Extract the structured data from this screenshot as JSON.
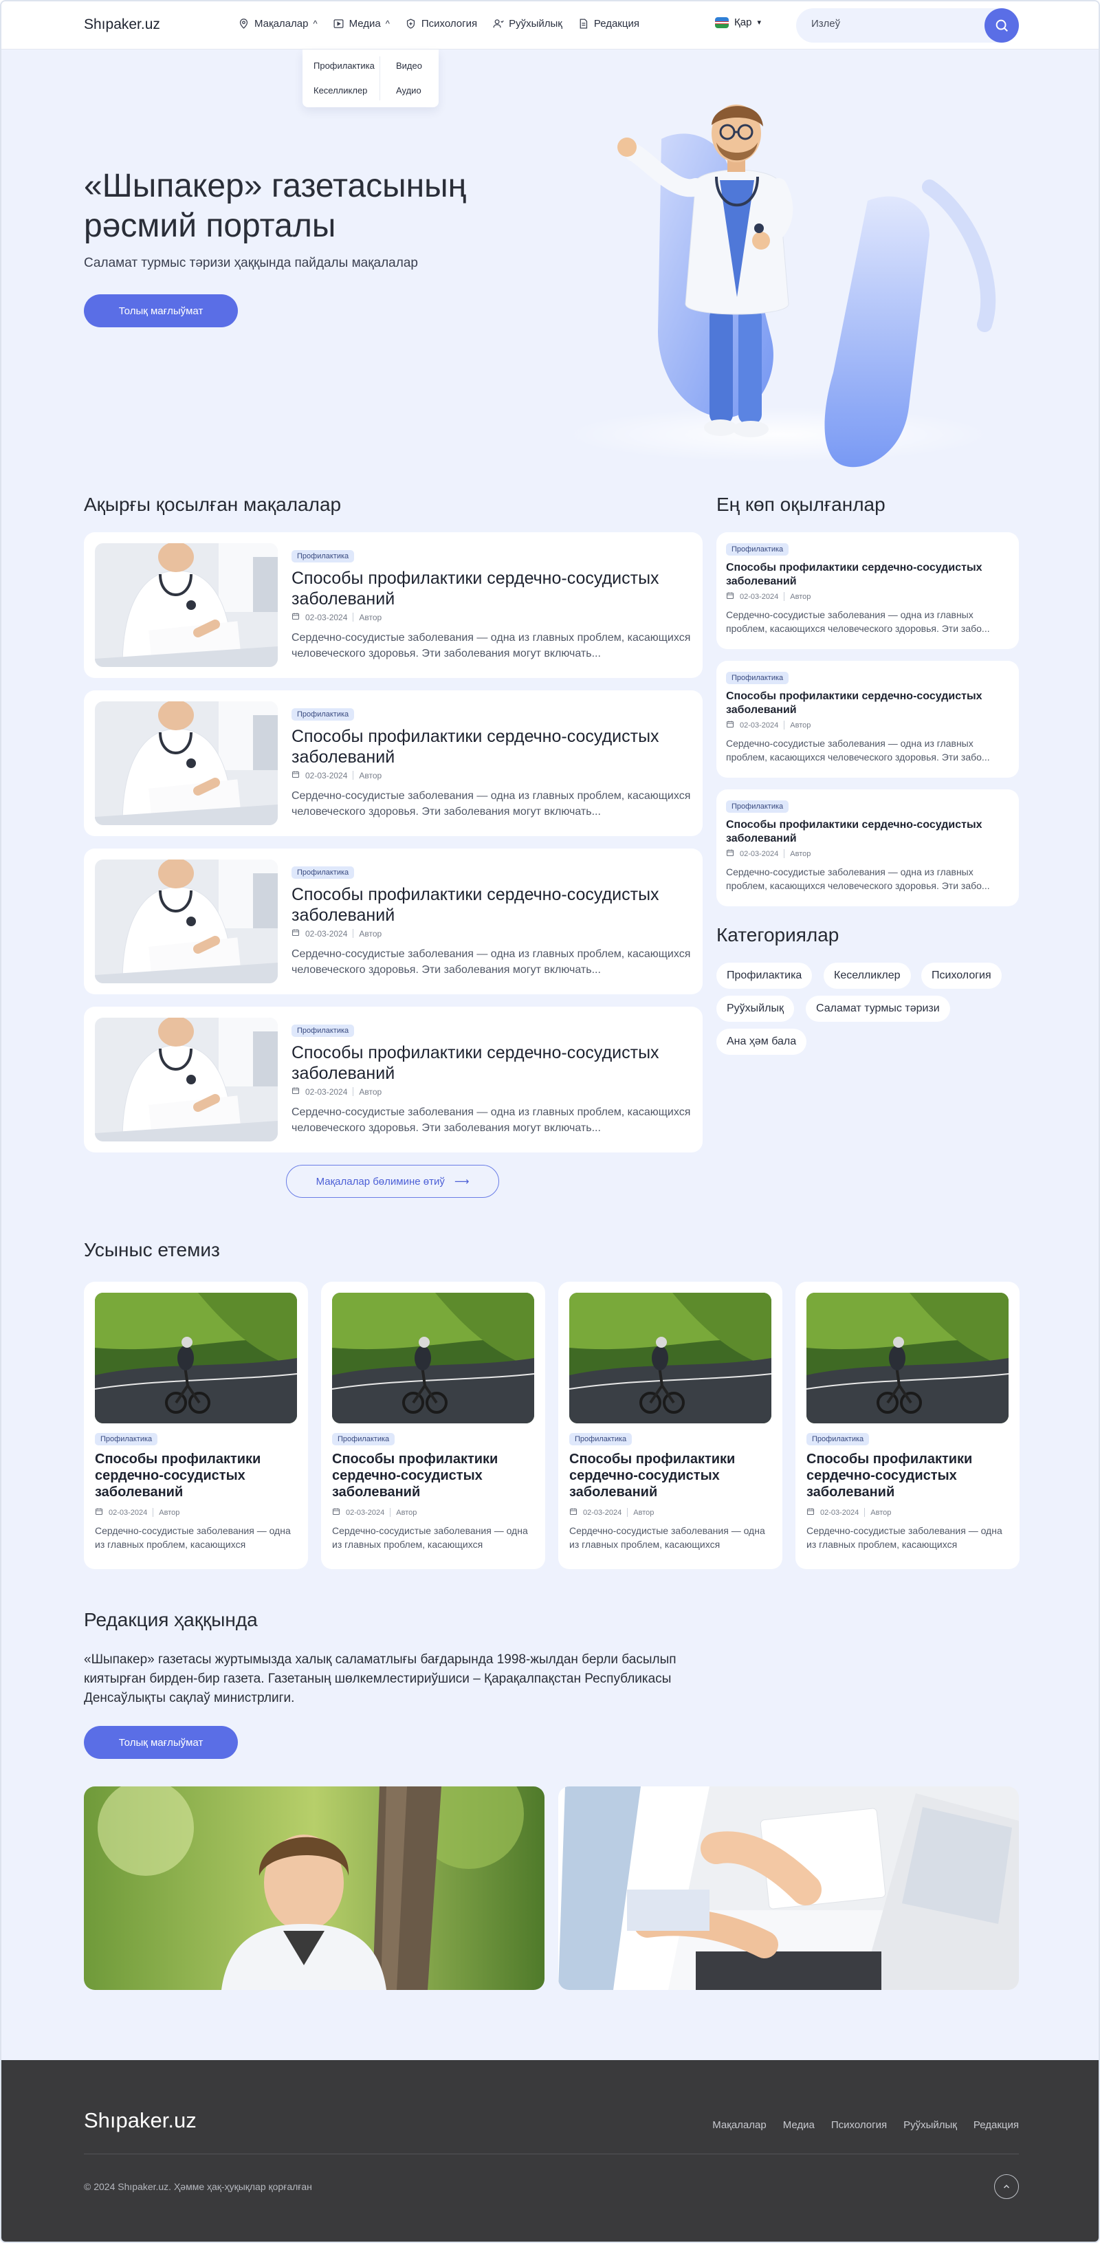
{
  "header": {
    "logo": "Shıpaker.uz",
    "nav": [
      {
        "label": "Мақалалар",
        "icon": "pin-icon",
        "caret": "^"
      },
      {
        "label": "Медиа",
        "icon": "play-icon",
        "caret": "^"
      },
      {
        "label": "Психология",
        "icon": "shield-icon"
      },
      {
        "label": "Руўхыйлық",
        "icon": "person-icon"
      },
      {
        "label": "Редакция",
        "icon": "document-icon"
      }
    ],
    "dropdown": [
      "Профилактика",
      "Кеселликлер",
      "Видео",
      "Аудио"
    ],
    "lang": {
      "label": "Қар",
      "caret": "▾"
    },
    "search_placeholder": "Излеў"
  },
  "hero": {
    "title_line1": "«Шыпакер» газетасының",
    "title_line2": "рәсмий порталы",
    "subtitle": "Саламат турмыс тәризи ҳаққында пайдалы мақалалар",
    "button": "Толық мағлыўмат"
  },
  "latest": {
    "title": "Ақырғы қосылған мақалалар",
    "items": [
      {
        "badge": "Профилактика",
        "title": "Способы профилактики сердечно-сосудистых заболеваний",
        "date": "02-03-2024",
        "author": "Автор",
        "excerpt": "Сердечно-сосудистые заболевания — одна из главных проблем, касающихся человеческого здоровья. Эти заболевания могут включать..."
      },
      {
        "badge": "Профилактика",
        "title": "Способы профилактики сердечно-сосудистых заболеваний",
        "date": "02-03-2024",
        "author": "Автор",
        "excerpt": "Сердечно-сосудистые заболевания — одна из главных проблем, касающихся человеческого здоровья. Эти заболевания могут включать..."
      },
      {
        "badge": "Профилактика",
        "title": "Способы профилактики сердечно-сосудистых заболеваний",
        "date": "02-03-2024",
        "author": "Автор",
        "excerpt": "Сердечно-сосудистые заболевания — одна из главных проблем, касающихся человеческого здоровья. Эти заболевания могут включать..."
      },
      {
        "badge": "Профилактика",
        "title": "Способы профилактики сердечно-сосудистых заболеваний",
        "date": "02-03-2024",
        "author": "Автор",
        "excerpt": "Сердечно-сосудистые заболевания — одна из главных проблем, касающихся человеческого здоровья. Эти заболевания могут включать..."
      }
    ],
    "more_button": "Мақалалар бөлимине өтиў",
    "more_arrow": "⟶"
  },
  "popular": {
    "title": "Ең көп оқылғанлар",
    "items": [
      {
        "badge": "Профилактика",
        "title": "Способы профилактики сердечно-сосудистых заболеваний",
        "date": "02-03-2024",
        "author": "Автор",
        "excerpt": "Сердечно-сосудистые заболевания — одна из главных проблем, касающихся человеческого здоровья. Эти забо..."
      },
      {
        "badge": "Профилактика",
        "title": "Способы профилактики сердечно-сосудистых заболеваний",
        "date": "02-03-2024",
        "author": "Автор",
        "excerpt": "Сердечно-сосудистые заболевания — одна из главных проблем, касающихся человеческого здоровья. Эти забо..."
      },
      {
        "badge": "Профилактика",
        "title": "Способы профилактики сердечно-сосудистых заболеваний",
        "date": "02-03-2024",
        "author": "Автор",
        "excerpt": "Сердечно-сосудистые заболевания — одна из главных проблем, касающихся человеческого здоровья. Эти забо..."
      }
    ]
  },
  "categories": {
    "title": "Категориялар",
    "items": [
      "Профилактика",
      "Кеселликлер",
      "Психология",
      "Руўхыйлық",
      "Саламат турмыс тәризи",
      "Ана ҳәм бала"
    ]
  },
  "recommend": {
    "title": "Усыныс етемиз",
    "items": [
      {
        "badge": "Профилактика",
        "title": "Способы профилактики сердечно-сосудистых заболеваний",
        "date": "02-03-2024",
        "author": "Автор",
        "excerpt": "Сердечно-сосудистые заболевания — одна из главных проблем, касающихся человеческого..."
      },
      {
        "badge": "Профилактика",
        "title": "Способы профилактики сердечно-сосудистых заболеваний",
        "date": "02-03-2024",
        "author": "Автор",
        "excerpt": "Сердечно-сосудистые заболевания — одна из главных проблем, касающихся человеческого..."
      },
      {
        "badge": "Профилактика",
        "title": "Способы профилактики сердечно-сосудистых заболеваний",
        "date": "02-03-2024",
        "author": "Автор",
        "excerpt": "Сердечно-сосудистые заболевания — одна из главных проблем, касающихся человеческого..."
      },
      {
        "badge": "Профилактика",
        "title": "Способы профилактики сердечно-сосудистых заболеваний",
        "date": "02-03-2024",
        "author": "Автор",
        "excerpt": "Сердечно-сосудистые заболевания — одна из главных проблем, касающихся человеческого..."
      }
    ]
  },
  "about": {
    "title": "Редакция ҳаққында",
    "text": "«Шыпакер» газетасы журтымызда халық саламатлығы бағдарында 1998-жылдан берли басылып киятырған бирден-бир газета. Газетаның шөлкемлестириўшиси – Қарақалпақстан Республикасы Денсаўлықты сақлаў министрлиги.",
    "button": "Толық мағлыўмат"
  },
  "footer": {
    "logo": "Shıpaker.uz",
    "nav": [
      "Мақалалар",
      "Медиа",
      "Психология",
      "Руўхыйлық",
      "Редакция"
    ],
    "copyright": "© 2024 Shıpaker.uz. Ҳәмме ҳақ-ҳуқықлар қорғалған"
  },
  "colors": {
    "accent": "#5a6ee6",
    "page_bg": "#eef2fd",
    "footer_bg": "#3a3a3c",
    "badge_bg": "#dfe8fb"
  }
}
